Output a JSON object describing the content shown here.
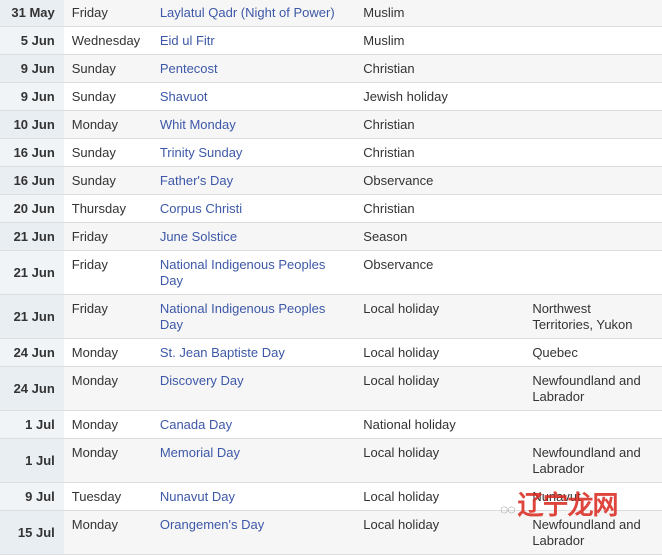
{
  "rows": [
    {
      "date": "31 May",
      "day": "Friday",
      "name": "Laylatul Qadr (Night of Power)",
      "type": "Muslim",
      "region": ""
    },
    {
      "date": "5 Jun",
      "day": "Wednesday",
      "name": "Eid ul Fitr",
      "type": "Muslim",
      "region": ""
    },
    {
      "date": "9 Jun",
      "day": "Sunday",
      "name": "Pentecost",
      "type": "Christian",
      "region": ""
    },
    {
      "date": "9 Jun",
      "day": "Sunday",
      "name": "Shavuot",
      "type": "Jewish holiday",
      "region": ""
    },
    {
      "date": "10 Jun",
      "day": "Monday",
      "name": "Whit Monday",
      "type": "Christian",
      "region": ""
    },
    {
      "date": "16 Jun",
      "day": "Sunday",
      "name": "Trinity Sunday",
      "type": "Christian",
      "region": ""
    },
    {
      "date": "16 Jun",
      "day": "Sunday",
      "name": "Father's Day",
      "type": "Observance",
      "region": ""
    },
    {
      "date": "20 Jun",
      "day": "Thursday",
      "name": "Corpus Christi",
      "type": "Christian",
      "region": ""
    },
    {
      "date": "21 Jun",
      "day": "Friday",
      "name": "June Solstice",
      "type": "Season",
      "region": ""
    },
    {
      "date": "21 Jun",
      "day": "Friday",
      "name": "National Indigenous Peoples Day",
      "type": "Observance",
      "region": ""
    },
    {
      "date": "21 Jun",
      "day": "Friday",
      "name": "National Indigenous Peoples Day",
      "type": "Local holiday",
      "region": "Northwest Territories, Yukon"
    },
    {
      "date": "24 Jun",
      "day": "Monday",
      "name": "St. Jean Baptiste Day",
      "type": "Local holiday",
      "region": "Quebec"
    },
    {
      "date": "24 Jun",
      "day": "Monday",
      "name": "Discovery Day",
      "type": "Local holiday",
      "region": "Newfoundland and Labrador"
    },
    {
      "date": "1 Jul",
      "day": "Monday",
      "name": "Canada Day",
      "type": "National holiday",
      "region": ""
    },
    {
      "date": "1 Jul",
      "day": "Monday",
      "name": "Memorial Day",
      "type": "Local holiday",
      "region": "Newfoundland and Labrador"
    },
    {
      "date": "9 Jul",
      "day": "Tuesday",
      "name": "Nunavut Day",
      "type": "Local holiday",
      "region": "Nunavut"
    },
    {
      "date": "15 Jul",
      "day": "Monday",
      "name": "Orangemen's Day",
      "type": "Local holiday",
      "region": "Newfoundland and Labrador"
    }
  ],
  "watermark": "辽宁龙网",
  "colors": {
    "link": "#3d58a8",
    "date_bg": "#e9eef3"
  }
}
